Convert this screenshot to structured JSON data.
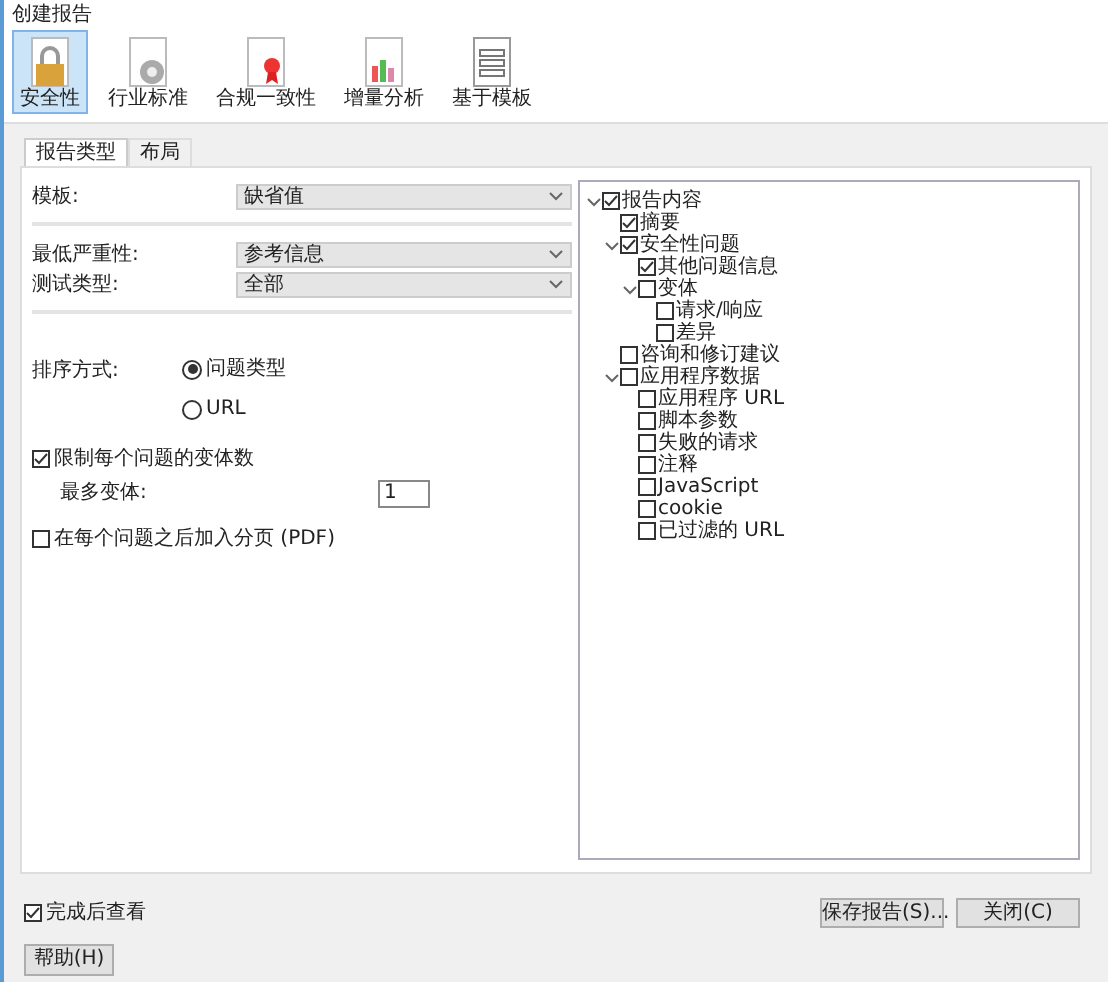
{
  "window": {
    "title": "创建报告"
  },
  "toolbar": [
    {
      "label": "安全性",
      "selected": true,
      "kind": "lock"
    },
    {
      "label": "行业标准",
      "selected": false,
      "kind": "gear"
    },
    {
      "label": "合规一致性",
      "selected": false,
      "kind": "ribbon"
    },
    {
      "label": "增量分析",
      "selected": false,
      "kind": "chart"
    },
    {
      "label": "基于模板",
      "selected": false,
      "kind": "form"
    }
  ],
  "tabs": [
    {
      "label": "报告类型",
      "selected": true
    },
    {
      "label": "布局",
      "selected": false
    }
  ],
  "fields": [
    {
      "label": "模板:",
      "value": "缺省值"
    },
    {
      "label": "最低严重性:",
      "value": "参考信息"
    },
    {
      "label": "测试类型:",
      "value": "全部"
    }
  ],
  "sort": {
    "label": "排序方式:",
    "options": [
      {
        "label": "问题类型",
        "selected": true
      },
      {
        "label": "URL",
        "selected": false
      }
    ]
  },
  "limit_variants": {
    "label": "限制每个问题的变体数",
    "checked": true,
    "max_label": "最多变体:",
    "max_value": "1"
  },
  "page_break": {
    "label": "在每个问题之后加入分页 (PDF)",
    "checked": false
  },
  "tree": [
    {
      "label": "报告内容",
      "checked": true,
      "expanded": true,
      "children": [
        {
          "label": "摘要",
          "checked": true
        },
        {
          "label": "安全性问题",
          "checked": true,
          "expanded": true,
          "children": [
            {
              "label": "其他问题信息",
              "checked": true
            },
            {
              "label": "变体",
              "checked": false,
              "expanded": true,
              "children": [
                {
                  "label": "请求/响应",
                  "checked": false
                },
                {
                  "label": "差异",
                  "checked": false
                }
              ]
            }
          ]
        },
        {
          "label": "咨询和修订建议",
          "checked": false
        },
        {
          "label": "应用程序数据",
          "checked": false,
          "expanded": true,
          "children": [
            {
              "label": "应用程序 URL",
              "checked": false
            },
            {
              "label": "脚本参数",
              "checked": false
            },
            {
              "label": "失败的请求",
              "checked": false
            },
            {
              "label": "注释",
              "checked": false
            },
            {
              "label": "JavaScript",
              "checked": false
            },
            {
              "label": "cookie",
              "checked": false
            },
            {
              "label": "已过滤的 URL",
              "checked": false
            }
          ]
        }
      ]
    }
  ],
  "view_after": {
    "label": "完成后查看",
    "checked": true
  },
  "buttons": [
    {
      "label": "保存报告(S)..."
    },
    {
      "label": "关闭(C)"
    }
  ],
  "help_button": {
    "label": "帮助(H)"
  }
}
